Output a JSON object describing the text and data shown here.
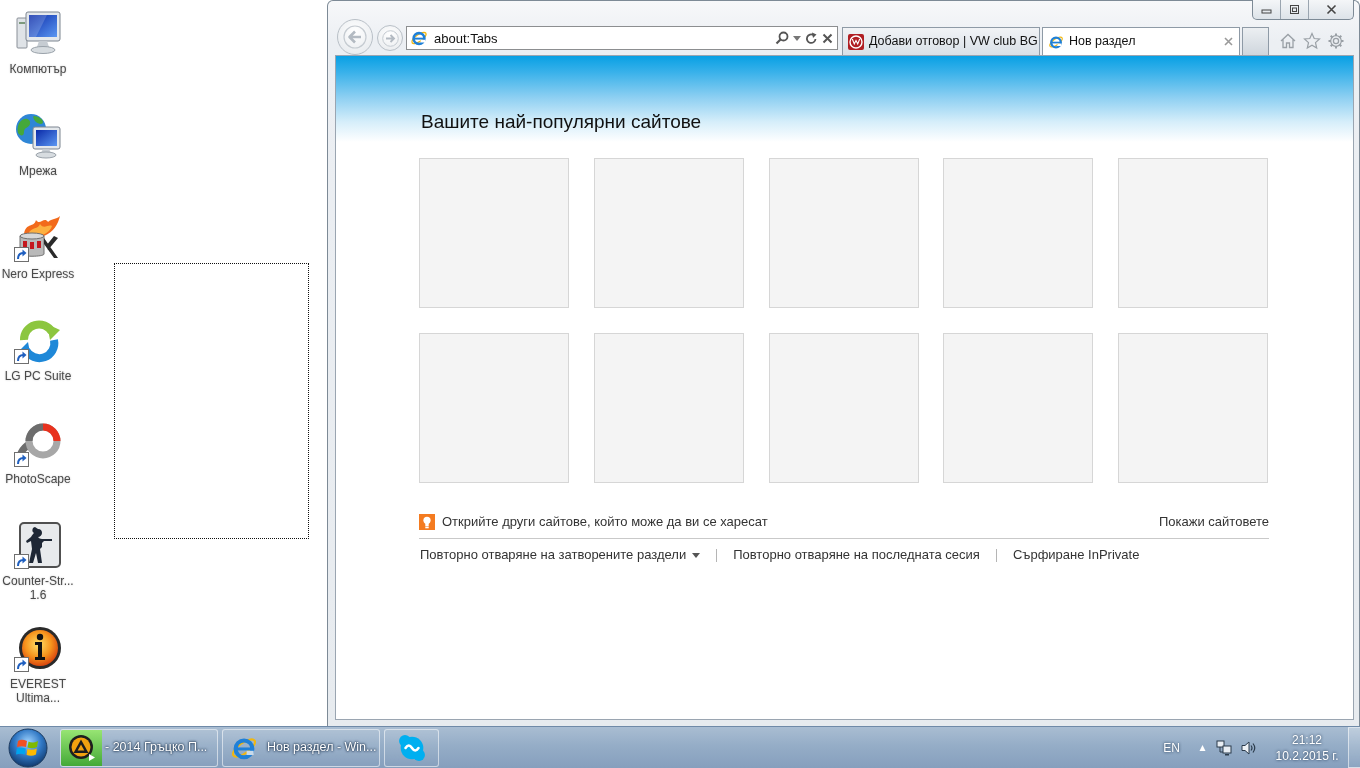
{
  "desktop": {
    "icons": [
      {
        "label": "Компютър",
        "kind": "computer",
        "shortcut": false
      },
      {
        "label": "Мрежа",
        "kind": "network",
        "shortcut": false
      },
      {
        "label": "Nero Express",
        "kind": "flame",
        "shortcut": true
      },
      {
        "label": "LG PC Suite",
        "kind": "sync",
        "shortcut": true
      },
      {
        "label": "PhotoScape",
        "kind": "aperture",
        "shortcut": true
      },
      {
        "label": "Counter-Str...\n1.6",
        "kind": "soldier",
        "shortcut": true
      },
      {
        "label": "EVEREST\nUltima...",
        "kind": "info",
        "shortcut": true
      }
    ]
  },
  "browser": {
    "address": "about:Tabs",
    "tabs": [
      {
        "title": "Добави отговор | VW club BG",
        "kind": "vw",
        "selected": false
      },
      {
        "title": "Нов раздел",
        "kind": "ie",
        "selected": true
      }
    ],
    "heading": "Вашите най-популярни сайтове",
    "discover": {
      "text": "Открийте други сайтове, който може да ви се харесат",
      "link": "Покажи сайтовете"
    },
    "actions": [
      {
        "label": "Повторно отваряне на затворените раздели",
        "dropdown": true
      },
      {
        "label": "Повторно отваряне на последната сесия",
        "dropdown": false
      },
      {
        "label": "Сърфиране InPrivate",
        "dropdown": false
      }
    ]
  },
  "taskbar": {
    "buttons": [
      {
        "label": "- 2014 Гръцко П...",
        "kind": "aimp",
        "level": 0.26
      },
      {
        "label": "Нов раздел - Win...",
        "kind": "ie"
      },
      {
        "kind": "skype"
      }
    ],
    "tray": {
      "language": "EN",
      "time": "21:12",
      "date": "10.2.2015 г."
    }
  }
}
